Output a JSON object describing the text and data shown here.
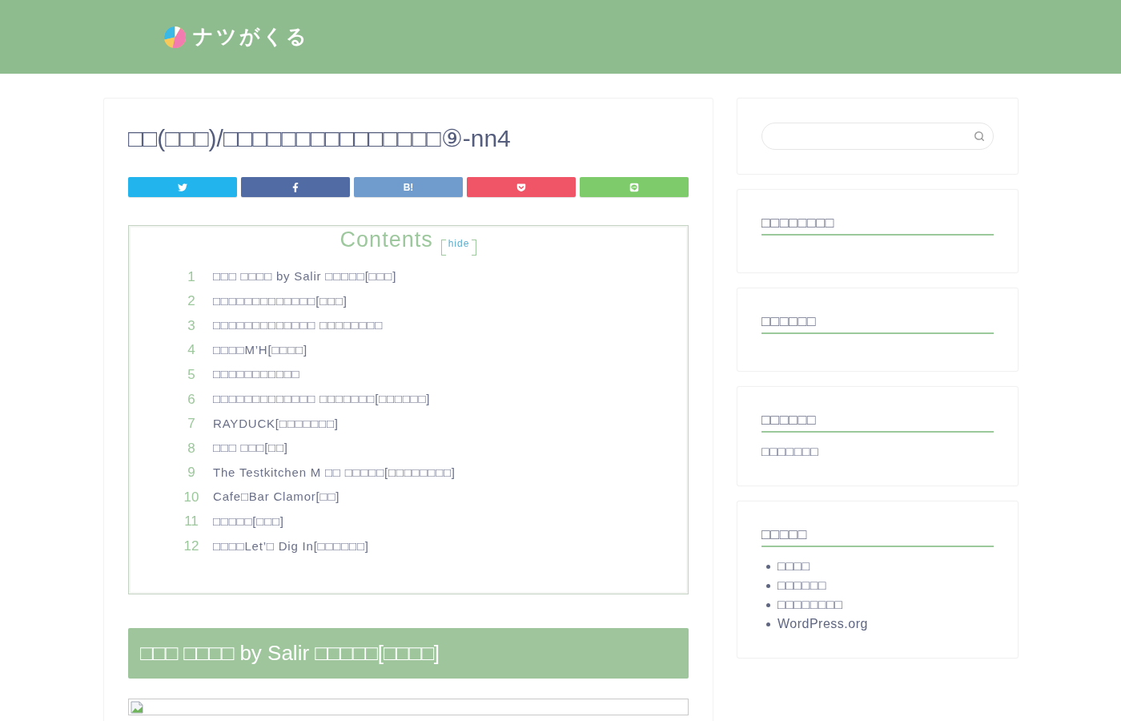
{
  "header": {
    "logo_text": "ナツがくる"
  },
  "article": {
    "title": "□□(□□□)/□□□□□□□□□□□□□□□⑨-nn4",
    "share_buttons": [
      {
        "kind": "twitter"
      },
      {
        "kind": "facebook"
      },
      {
        "kind": "hatena",
        "label": "B!"
      },
      {
        "kind": "pocket"
      },
      {
        "kind": "line"
      }
    ],
    "toc": {
      "title": "Contents",
      "toggle": "hide",
      "items": [
        {
          "number": "1",
          "text": "□□□ □□□□ by Salir □□□□□[□□□]"
        },
        {
          "number": "2",
          "text": "□□□□□□□□□□□□□[□□□]"
        },
        {
          "number": "3",
          "text": "□□□□□□□□□□□□□ □□□□□□□□"
        },
        {
          "number": "4",
          "text": "□□□□M’H[□□□□]"
        },
        {
          "number": "5",
          "text": "□□□□□□□□□□□"
        },
        {
          "number": "6",
          "text": "□□□□□□□□□□□□□ □□□□□□□[□□□□□□]"
        },
        {
          "number": "7",
          "text": "RAYDUCK[□□□□□□□]"
        },
        {
          "number": "8",
          "text": "□□□ □□□[□□]"
        },
        {
          "number": "9",
          "text": "The Testkitchen M □□ □□□□□[□□□□□□□□]"
        },
        {
          "number": "10",
          "text": "Cafe□Bar Clamor[□□]"
        },
        {
          "number": "11",
          "text": "□□□□□[□□□]"
        },
        {
          "number": "12",
          "text": "□□□□Let’□ Dig In[□□□□□□]"
        }
      ]
    },
    "section_heading": "□□□ □□□□ by Salir □□□□□[□□□□]"
  },
  "sidebar": {
    "widgets": [
      {
        "kind": "search"
      },
      {
        "kind": "plain",
        "title": "□□□□□□□□"
      },
      {
        "kind": "plain",
        "title": "□□□□□□"
      },
      {
        "kind": "plain",
        "title": "□□□□□□",
        "items": [
          "□□□□□□□"
        ]
      },
      {
        "kind": "bullets",
        "title": "□□□□□",
        "items": [
          "□□□□",
          "□□□□□□",
          "□□□□□□□□",
          "WordPress.org"
        ]
      }
    ]
  }
}
